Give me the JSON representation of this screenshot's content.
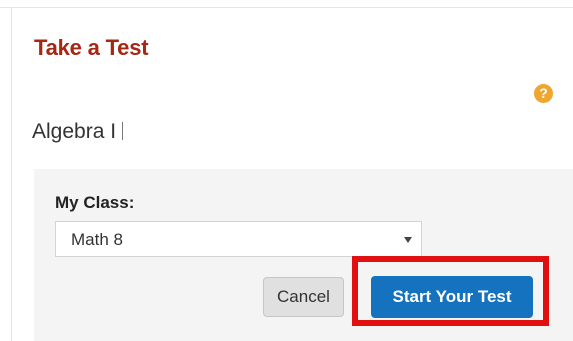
{
  "header": {
    "title": "Take a Test",
    "help_icon_glyph": "?"
  },
  "test": {
    "name": "Algebra I"
  },
  "class_selector": {
    "label": "My Class:",
    "selected_value": "Math 8"
  },
  "actions": {
    "cancel_label": "Cancel",
    "start_label": "Start Your Test"
  },
  "colors": {
    "title": "#a52714",
    "help_icon": "#f0a52c",
    "start_button": "#1472be",
    "highlight": "#e01010"
  },
  "icons": {
    "help": "question-circle-icon",
    "dropdown": "chevron-down-icon"
  }
}
